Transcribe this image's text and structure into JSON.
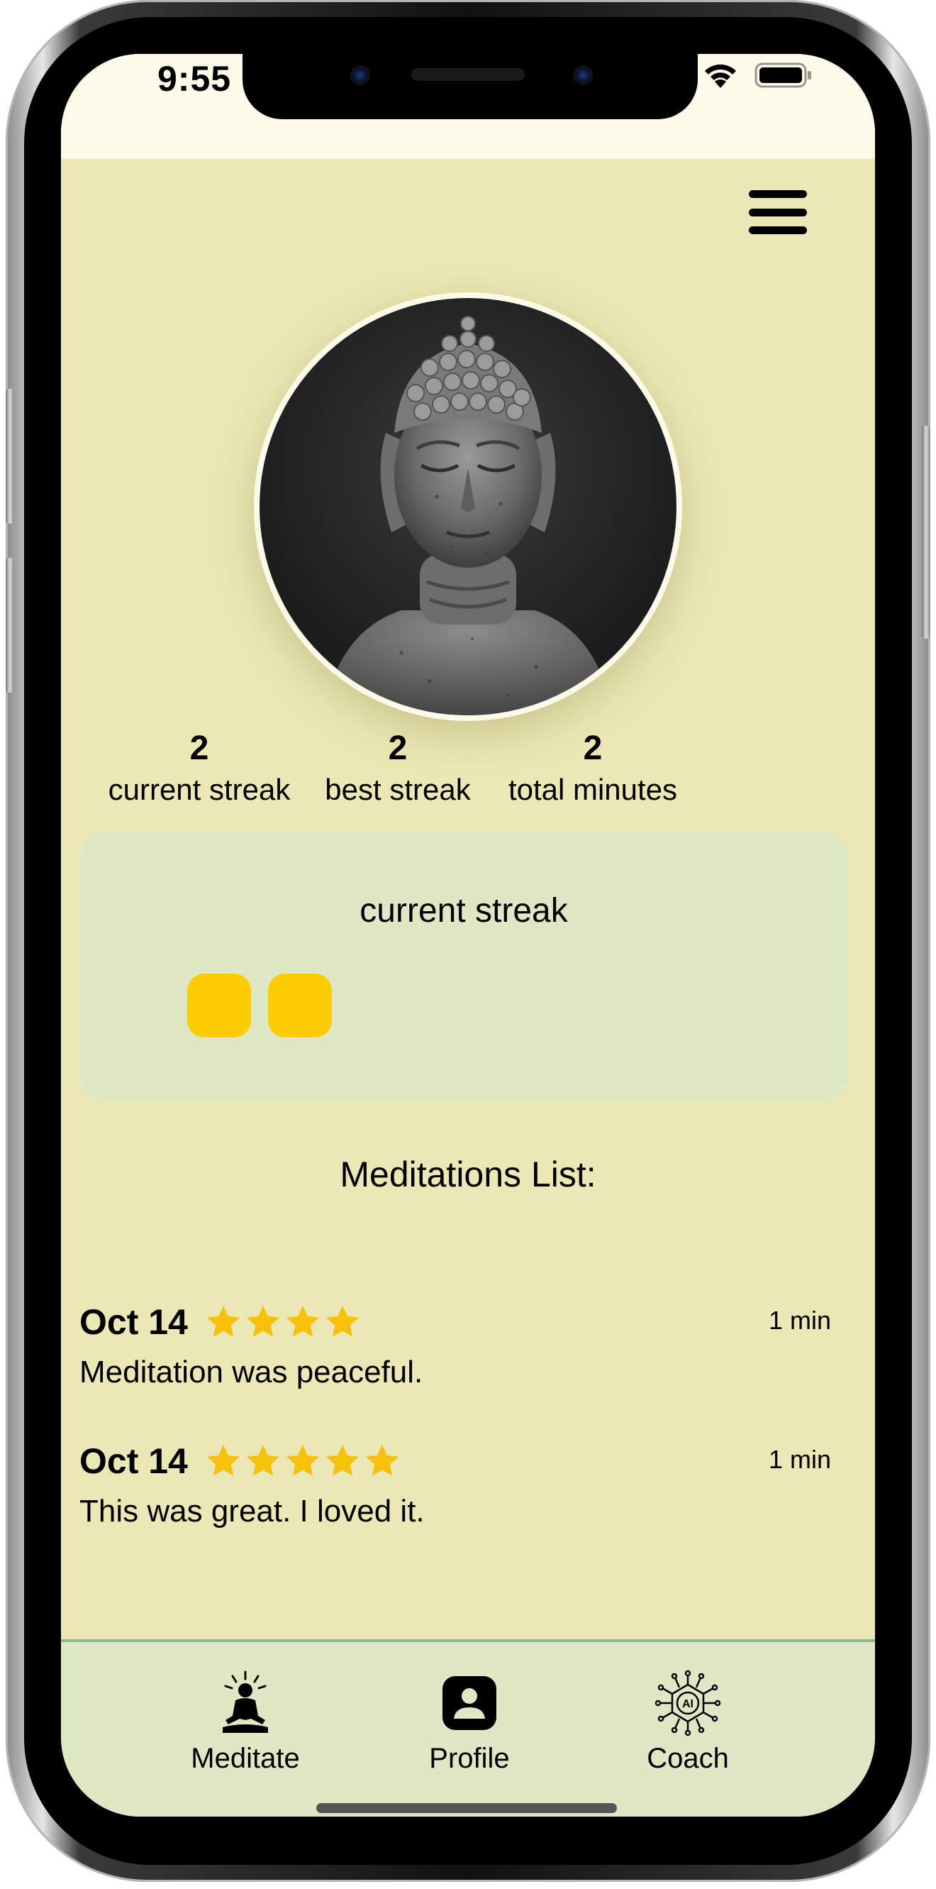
{
  "status_bar": {
    "time": "9:55",
    "icons": [
      "wifi-icon",
      "battery-icon"
    ]
  },
  "header": {
    "menu_icon": "hamburger-menu-icon"
  },
  "profile": {
    "avatar_alt": "buddha-statue-avatar"
  },
  "stats": [
    {
      "value": "2",
      "label": "current streak"
    },
    {
      "value": "2",
      "label": "best streak"
    },
    {
      "value": "2",
      "label": "total minutes"
    }
  ],
  "streak_card": {
    "title": "current streak",
    "day_count": 2,
    "box_color": "#fccd04"
  },
  "meditations": {
    "title": "Meditations List:",
    "items": [
      {
        "date": "Oct 14",
        "stars": 4,
        "duration": "1 min",
        "note": "Meditation was peaceful."
      },
      {
        "date": "Oct 14",
        "stars": 5,
        "duration": "1 min",
        "note": "This was great. I loved it."
      }
    ]
  },
  "tabbar": {
    "tabs": [
      {
        "label": "Meditate",
        "icon": "meditation-person-icon"
      },
      {
        "label": "Profile",
        "icon": "profile-icon",
        "active": true
      },
      {
        "label": "Coach",
        "icon": "ai-chip-icon"
      }
    ]
  },
  "colors": {
    "background": "#ebe8b5",
    "card": "#dfe8c5",
    "accent": "#fccd04",
    "star": "#f7c10a",
    "tab_border": "#8bb89a"
  }
}
